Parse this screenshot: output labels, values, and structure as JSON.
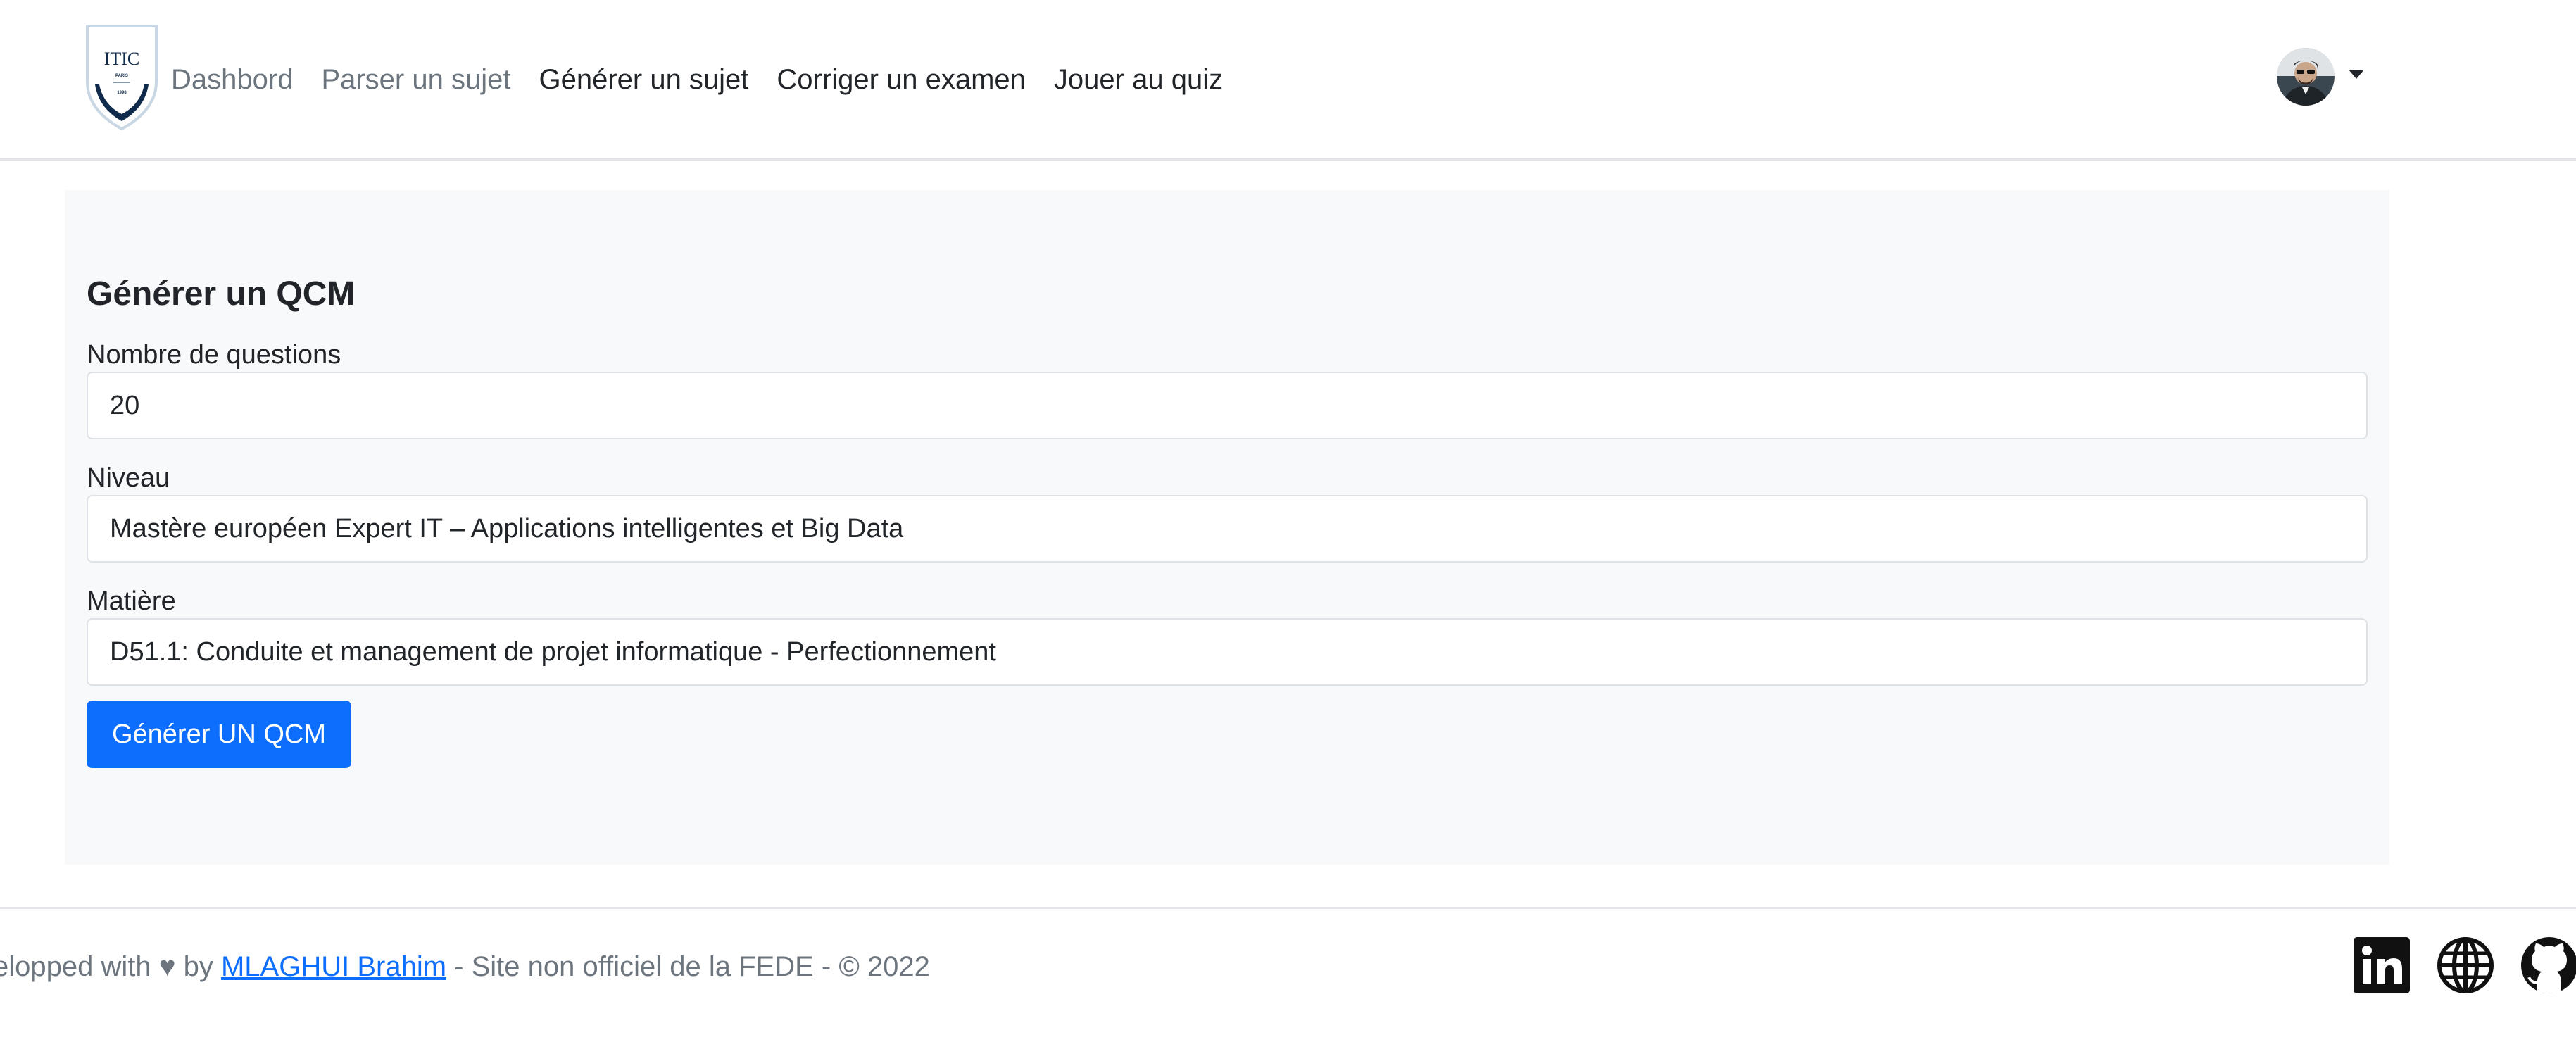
{
  "nav": {
    "logo": {
      "text": "ITIC",
      "sub1": "PARIS",
      "sub2": "1998"
    },
    "links": [
      {
        "label": "Dashbord",
        "state": "muted"
      },
      {
        "label": "Parser un sujet",
        "state": "muted"
      },
      {
        "label": "Générer un sujet",
        "state": "dark"
      },
      {
        "label": "Corriger un examen",
        "state": "dark"
      },
      {
        "label": "Jouer au quiz",
        "state": "dark"
      }
    ],
    "user_menu": {
      "avatar_icon": "user-avatar",
      "caret_icon": "caret-down-icon"
    }
  },
  "form": {
    "title": "Générer un QCM",
    "fields": {
      "questions": {
        "label": "Nombre de questions",
        "value": "20"
      },
      "niveau": {
        "label": "Niveau",
        "value": "Mastère européen Expert IT – Applications intelligentes et Big Data"
      },
      "matiere": {
        "label": "Matière",
        "value": "D51.1: Conduite et management de projet informatique - Perfectionnement"
      }
    },
    "submit_label": "Générer UN QCM"
  },
  "footer": {
    "prefix": "elopped with ♥ by",
    "author_link": "MLAGHUI Brahim",
    "suffix": "- Site non officiel de la FEDE - © 2022",
    "icons": [
      "linkedin-icon",
      "globe-icon",
      "github-icon"
    ]
  },
  "colors": {
    "primary": "#0d6efd",
    "card_bg": "#f8f9fa",
    "muted_text": "#6c757d",
    "logo_navy": "#0f2a4a"
  }
}
